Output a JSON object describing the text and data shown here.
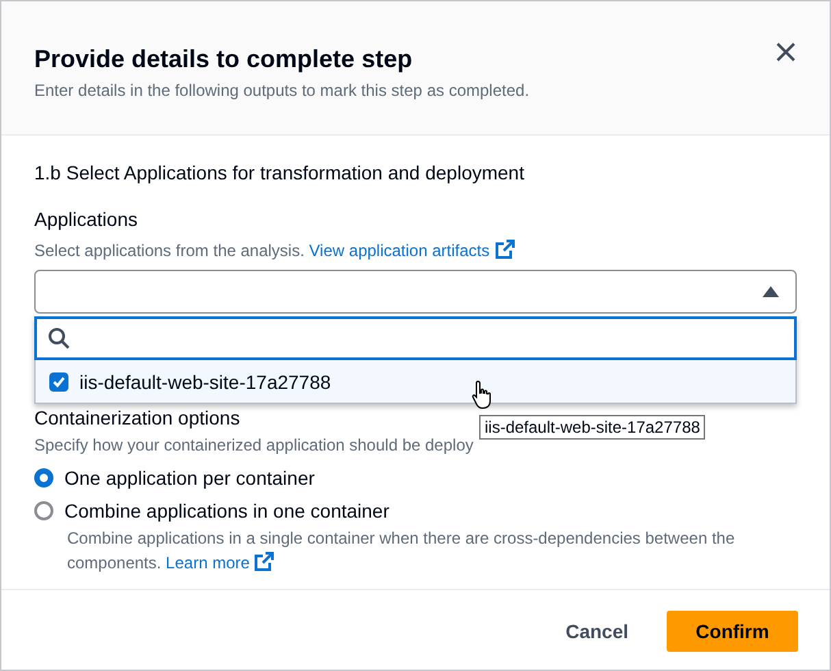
{
  "dialog": {
    "title": "Provide details to complete step",
    "description": "Enter details in the following outputs to mark this step as completed."
  },
  "section_heading": "1.b Select Applications for transformation and deployment",
  "applications": {
    "label": "Applications",
    "description": "Select applications from the analysis.",
    "link": "View application artifacts",
    "expanded": true,
    "options": [
      {
        "label": "iis-default-web-site-17a27788",
        "checked": true,
        "highlighted": true
      }
    ],
    "tooltip": "iis-default-web-site-17a27788"
  },
  "containerization": {
    "label": "Containerization options",
    "description": "Specify how your containerized application should be deploy",
    "options": [
      {
        "label": "One application per container",
        "selected": true
      },
      {
        "label": "Combine applications in one container",
        "selected": false,
        "description": "Combine applications in a single container when there are cross-dependencies between the components.",
        "link": "Learn more"
      }
    ]
  },
  "buttons": [
    {
      "label": "Cancel",
      "kind": "link"
    },
    {
      "label": "Confirm",
      "kind": "primary"
    }
  ]
}
